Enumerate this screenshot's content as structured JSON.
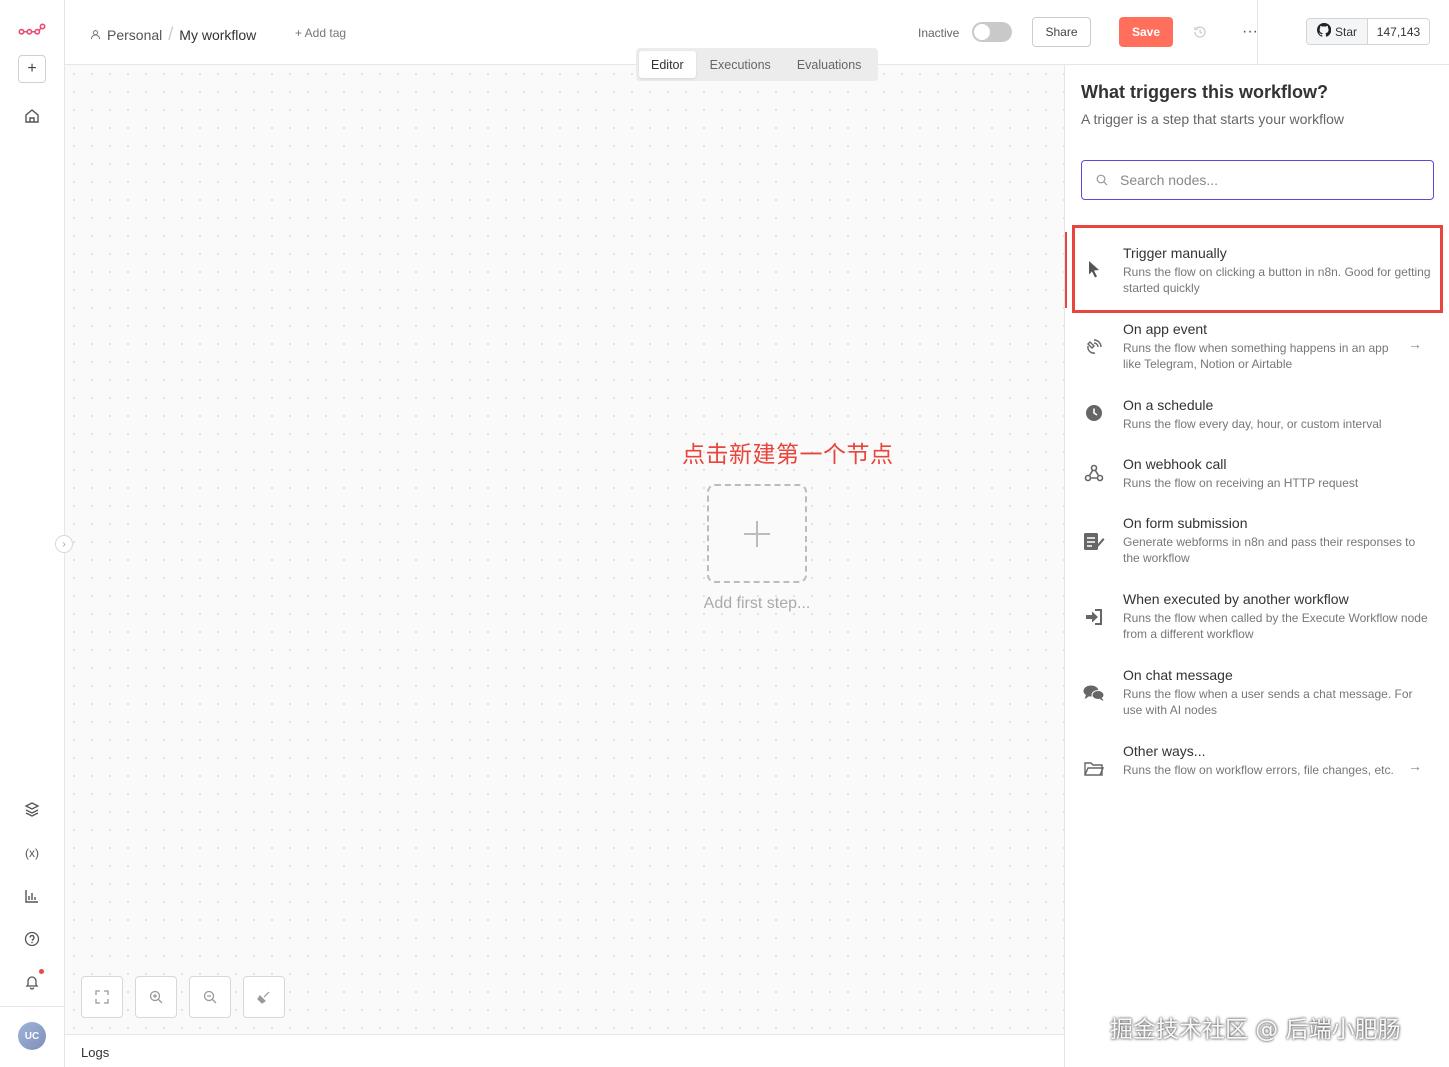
{
  "header": {
    "project": "Personal",
    "workflow_name": "My workflow",
    "add_tag": "+ Add tag",
    "inactive_label": "Inactive",
    "share_label": "Share",
    "save_label": "Save",
    "github_star_label": "Star",
    "github_star_count": "147,143"
  },
  "tabs": [
    "Editor",
    "Executions",
    "Evaluations"
  ],
  "active_tab": "Editor",
  "canvas": {
    "annotation": "点击新建第一个节点",
    "add_first_step": "Add first step..."
  },
  "logs_label": "Logs",
  "panel": {
    "title": "What triggers this workflow?",
    "subtitle": "A trigger is a step that starts your workflow",
    "search_placeholder": "Search nodes...",
    "items": [
      {
        "title": "Trigger manually",
        "desc": "Runs the flow on clicking a button in n8n. Good for getting started quickly",
        "icon": "cursor-icon"
      },
      {
        "title": "On app event",
        "desc": "Runs the flow when something happens in an app like Telegram, Notion or Airtable",
        "icon": "satellite-icon"
      },
      {
        "title": "On a schedule",
        "desc": "Runs the flow every day, hour, or custom interval",
        "icon": "clock-icon"
      },
      {
        "title": "On webhook call",
        "desc": "Runs the flow on receiving an HTTP request",
        "icon": "webhook-icon"
      },
      {
        "title": "On form submission",
        "desc": "Generate webforms in n8n and pass their responses to the workflow",
        "icon": "form-icon"
      },
      {
        "title": "When executed by another workflow",
        "desc": "Runs the flow when called by the Execute Workflow node from a different workflow",
        "icon": "sign-in-icon"
      },
      {
        "title": "On chat message",
        "desc": "Runs the flow when a user sends a chat message. For use with AI nodes",
        "icon": "chat-icon"
      },
      {
        "title": "Other ways...",
        "desc": "Runs the flow on workflow errors, file changes, etc.",
        "icon": "folder-icon"
      }
    ]
  },
  "user_avatar": "UC",
  "watermark": "掘金技术社区 @ 后端小肥肠",
  "colors": {
    "accent": "#5b4bd5",
    "save": "#ff6f5c",
    "annotation": "#e8453c",
    "brand": "#ea4b71"
  }
}
